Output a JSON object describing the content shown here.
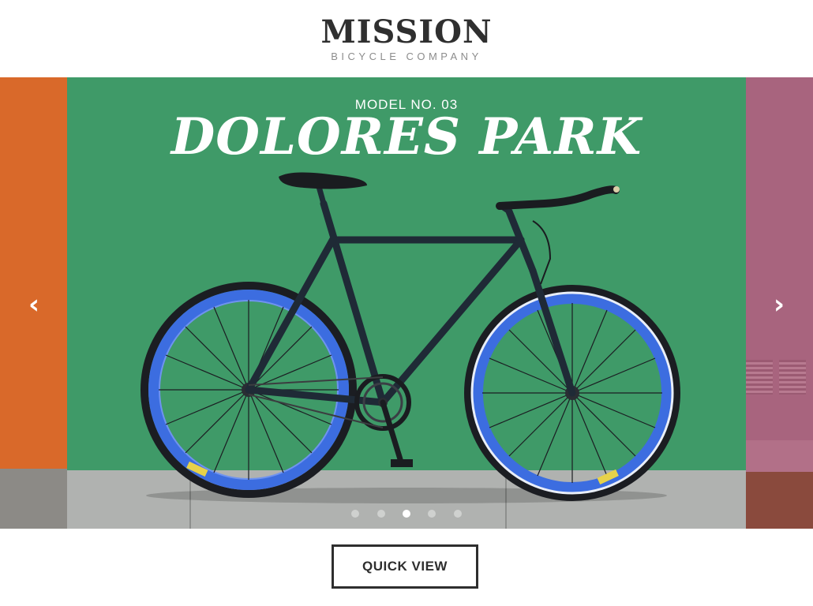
{
  "brand": {
    "name": "MISSION",
    "tagline": "BICYCLE COMPANY"
  },
  "slide": {
    "subtitle": "MODEL NO. 03",
    "title": "DOLORES PARK"
  },
  "carousel": {
    "prev_icon": "chevron-left-icon",
    "next_icon": "chevron-right-icon",
    "dots": 5,
    "active_index": 2
  },
  "cta": {
    "label": "QUICK VIEW"
  },
  "colors": {
    "wall_green": "#3f9a68",
    "left_wall_orange": "#d9692a",
    "right_wall_pink": "#b27088",
    "frame": "#1f2a36",
    "rim_blue": "#3c6de0",
    "text_dark": "#2e2e2e"
  }
}
